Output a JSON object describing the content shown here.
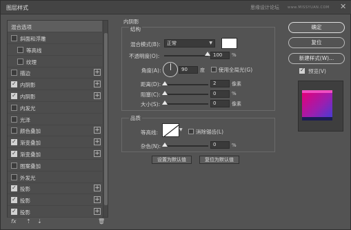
{
  "window": {
    "title": "图层样式",
    "watermark": "思缘设计论坛",
    "watermark_url": "www.MISSYUAN.COM",
    "close_glyph": "✕"
  },
  "styles_list": {
    "header": "混合选项",
    "items": [
      {
        "label": "斜面和浮雕",
        "checked": false,
        "indent": 0,
        "plus": false
      },
      {
        "label": "等高线",
        "checked": false,
        "indent": 1,
        "plus": false
      },
      {
        "label": "纹理",
        "checked": false,
        "indent": 1,
        "plus": false
      },
      {
        "label": "描边",
        "checked": false,
        "indent": 0,
        "plus": true
      },
      {
        "label": "内阴影",
        "checked": true,
        "indent": 0,
        "plus": true
      },
      {
        "label": "内阴影",
        "checked": true,
        "indent": 0,
        "plus": true
      },
      {
        "label": "内发光",
        "checked": false,
        "indent": 0,
        "plus": false
      },
      {
        "label": "光泽",
        "checked": false,
        "indent": 0,
        "plus": false
      },
      {
        "label": "颜色叠加",
        "checked": false,
        "indent": 0,
        "plus": true
      },
      {
        "label": "渐变叠加",
        "checked": true,
        "indent": 0,
        "plus": true
      },
      {
        "label": "渐变叠加",
        "checked": true,
        "indent": 0,
        "plus": true
      },
      {
        "label": "图案叠加",
        "checked": false,
        "indent": 0,
        "plus": false
      },
      {
        "label": "外发光",
        "checked": false,
        "indent": 0,
        "plus": false
      },
      {
        "label": "投影",
        "checked": true,
        "indent": 0,
        "plus": true
      },
      {
        "label": "投影",
        "checked": true,
        "indent": 0,
        "plus": true
      },
      {
        "label": "投影",
        "checked": true,
        "indent": 0,
        "plus": true
      }
    ],
    "plus_glyph": "+",
    "footer": {
      "fx": "fx",
      "up": "⇡",
      "down": "⇣",
      "trash": "🗑"
    }
  },
  "inner_shadow": {
    "panel_title": "内阴影",
    "structure_title": "结构",
    "blend_mode_label": "混合模式(B):",
    "blend_mode_value": "正常",
    "opacity_label": "不透明度(O):",
    "opacity_value": "100",
    "opacity_unit": "%",
    "angle_label": "角度(A):",
    "angle_value": "90",
    "angle_unit": "度",
    "global_light_label": "使用全局光(G)",
    "distance_label": "距离(D):",
    "distance_value": "2",
    "distance_unit": "像素",
    "choke_label": "阻塞(C):",
    "choke_value": "0",
    "choke_unit": "%",
    "size_label": "大小(S):",
    "size_value": "0",
    "size_unit": "像素",
    "quality_title": "品质",
    "contour_label": "等高线:",
    "anti_alias_label": "消除锯齿(L)",
    "noise_label": "杂色(N):",
    "noise_value": "0",
    "noise_unit": "%",
    "set_default_button": "设置为默认值",
    "reset_default_button": "复位为默认值",
    "shadow_color": "#ffffff"
  },
  "buttons": {
    "ok": "确定",
    "reset": "复位",
    "new_style": "新建样式(W)...",
    "preview_label": "预览(V)",
    "preview_checked": true
  },
  "colors": {
    "thumb_gradient_start": "#e4007a",
    "thumb_gradient_end": "#3d3fd8"
  }
}
